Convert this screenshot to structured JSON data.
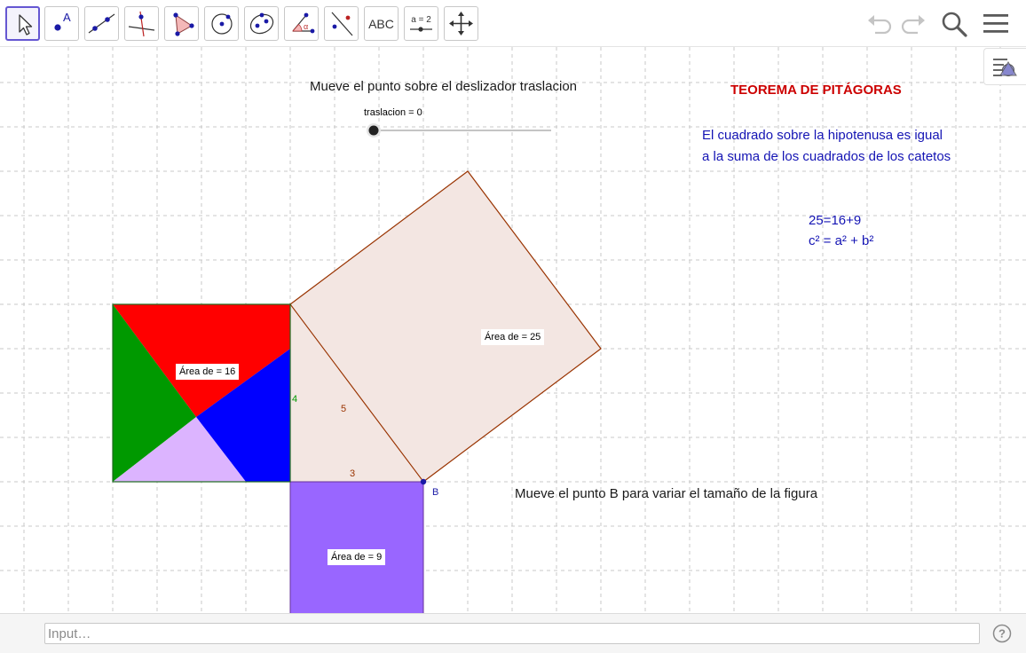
{
  "toolbar": {
    "tools": [
      {
        "name": "move-tool-icon"
      },
      {
        "name": "point-tool-icon"
      },
      {
        "name": "line-tool-icon"
      },
      {
        "name": "perpendicular-line-tool-icon"
      },
      {
        "name": "polygon-tool-icon"
      },
      {
        "name": "circle-center-point-tool-icon"
      },
      {
        "name": "conic-tool-icon"
      },
      {
        "name": "angle-tool-icon"
      },
      {
        "name": "reflect-tool-icon"
      },
      {
        "name": "text-tool-icon",
        "label": "ABC"
      },
      {
        "name": "slider-tool-icon",
        "label": "a = 2"
      },
      {
        "name": "move-graphics-view-tool-icon"
      }
    ],
    "selected_tool": "move-tool-icon",
    "right_icons": [
      "undo-icon",
      "redo-icon",
      "search-icon",
      "menu-icon"
    ]
  },
  "canvas": {
    "slider_instruction": "Mueve el punto sobre el deslizador traslacion",
    "slider": {
      "label": "traslacion = 0",
      "value": 0
    },
    "title": "TEOREMA DE PITÁGORAS",
    "statement_line1": "El cuadrado sobre la hipotenusa es igual",
    "statement_line2": "a la suma de los cuadrados de los catetos",
    "equation1": "25=16+9",
    "equation2": "c² = a² + b²",
    "area_hypotenuse": "Área de  = 25",
    "area_leg_a": "Área de  = 16",
    "area_leg_b": "Área de  = 9",
    "side_a": "4",
    "side_b": "3",
    "side_c": "5",
    "point_b_label": "B",
    "point_b_instruction": "Mueve el punto B para variar el tamaño de la figura"
  },
  "colors": {
    "red_piece": "#ff0000",
    "green_piece": "#009900",
    "blue_piece": "#0000ff",
    "lilac_piece": "#dcb4ff",
    "small_square": "#9966ff",
    "hypotenuse_square_fill": "#f3e6e2",
    "hypotenuse_square_stroke": "#993300",
    "accent": "#6557d2"
  },
  "input_bar": {
    "placeholder": "Input…"
  }
}
